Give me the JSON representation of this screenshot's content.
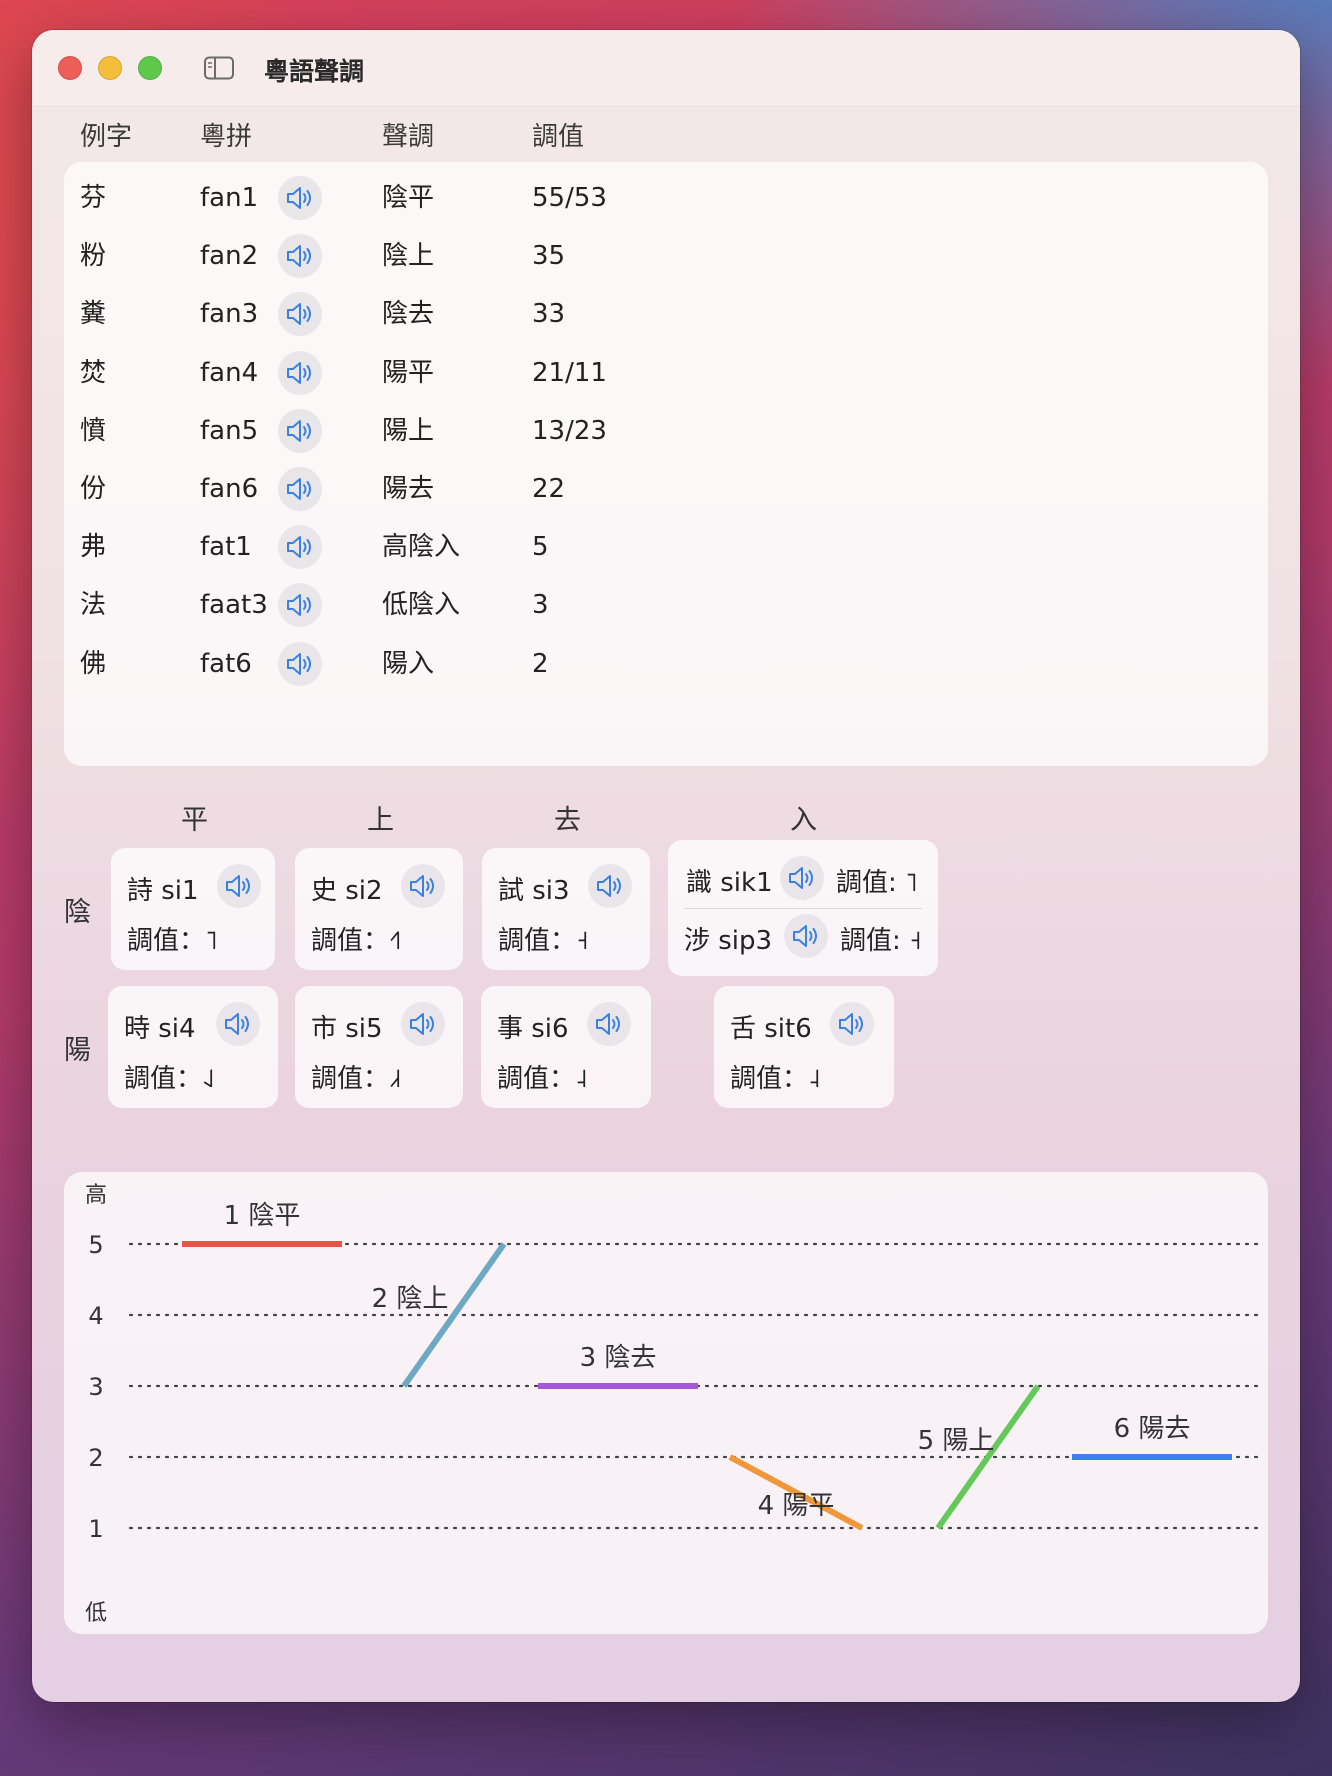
{
  "window": {
    "title": "粵語聲調"
  },
  "table": {
    "headers": {
      "char": "例字",
      "jyutping": "粵拼",
      "tone": "聲調",
      "value": "調值"
    },
    "rows": [
      {
        "char": "芬",
        "jyutping": "fan1",
        "tone": "陰平",
        "value": "55/53"
      },
      {
        "char": "粉",
        "jyutping": "fan2",
        "tone": "陰上",
        "value": "35"
      },
      {
        "char": "糞",
        "jyutping": "fan3",
        "tone": "陰去",
        "value": "33"
      },
      {
        "char": "焚",
        "jyutping": "fan4",
        "tone": "陽平",
        "value": "21/11"
      },
      {
        "char": "憤",
        "jyutping": "fan5",
        "tone": "陽上",
        "value": "13/23"
      },
      {
        "char": "份",
        "jyutping": "fan6",
        "tone": "陽去",
        "value": "22"
      },
      {
        "char": "弗",
        "jyutping": "fat1",
        "tone": "高陰入",
        "value": "5"
      },
      {
        "char": "法",
        "jyutping": "faat3",
        "tone": "低陰入",
        "value": "3"
      },
      {
        "char": "佛",
        "jyutping": "fat6",
        "tone": "陽入",
        "value": "2"
      }
    ]
  },
  "grid": {
    "columns": [
      "平",
      "上",
      "去",
      "入"
    ],
    "rows": [
      "陰",
      "陽"
    ],
    "yin": {
      "ping": {
        "word": "詩 si1",
        "value": "調值：˥"
      },
      "shang": {
        "word": "史 si2",
        "value": "調值：˧˥"
      },
      "qu": {
        "word": "試 si3",
        "value": "調值：˧"
      },
      "ru": [
        {
          "word": "識 sik1",
          "value": "調值: ˥"
        },
        {
          "word": "涉 sip3",
          "value": "調值: ˧"
        }
      ]
    },
    "yang": {
      "ping": {
        "word": "時 si4",
        "value": "調值：˨˩"
      },
      "shang": {
        "word": "市 si5",
        "value": "調值：˩˧"
      },
      "qu": {
        "word": "事 si6",
        "value": "調值：˨"
      },
      "ru": {
        "word": "舌 sit6",
        "value": "調值：˨"
      }
    }
  },
  "chart_data": {
    "type": "line",
    "title": "",
    "ylabel_top": "高",
    "ylabel_bottom": "低",
    "y_ticks": [
      "5",
      "4",
      "3",
      "2",
      "1"
    ],
    "ylim": [
      1,
      5
    ],
    "grid": "dotted",
    "series": [
      {
        "name": "1 陰平",
        "values": [
          5,
          5
        ],
        "color": "#e4554a"
      },
      {
        "name": "2 陰上",
        "values": [
          3,
          5
        ],
        "color": "#6ea9c4"
      },
      {
        "name": "3 陰去",
        "values": [
          3,
          3
        ],
        "color": "#a45ad6"
      },
      {
        "name": "4 陽平",
        "values": [
          2,
          1
        ],
        "color": "#f0973a"
      },
      {
        "name": "5 陽上",
        "values": [
          1,
          3
        ],
        "color": "#64c95a"
      },
      {
        "name": "6 陽去",
        "values": [
          2,
          2
        ],
        "color": "#3a7ff0"
      }
    ]
  }
}
